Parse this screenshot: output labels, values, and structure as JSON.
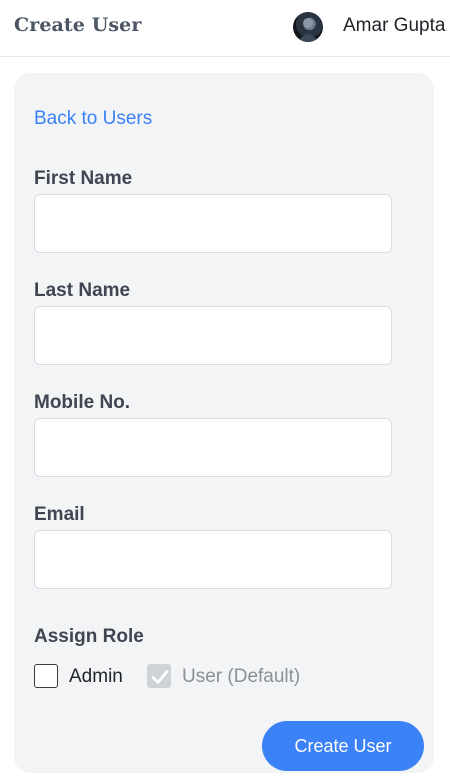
{
  "header": {
    "title": "Create User",
    "user": {
      "name": "Amar Gupta",
      "avatar_icon": "user-avatar"
    }
  },
  "form": {
    "back_link": "Back to Users",
    "fields": [
      {
        "label": "First Name",
        "value": "",
        "placeholder": ""
      },
      {
        "label": "Last Name",
        "value": "",
        "placeholder": ""
      },
      {
        "label": "Mobile No.",
        "value": "",
        "placeholder": ""
      },
      {
        "label": "Email",
        "value": "",
        "placeholder": ""
      }
    ],
    "role": {
      "label": "Assign Role",
      "options": [
        {
          "label": "Admin",
          "checked": false,
          "disabled": false
        },
        {
          "label": "User (Default)",
          "checked": true,
          "disabled": true
        }
      ]
    },
    "submit_label": "Create User"
  },
  "colors": {
    "accent": "#3b82f6",
    "card_background": "#f3f4f6",
    "disabled_checkbox": "#cfd3d8"
  }
}
